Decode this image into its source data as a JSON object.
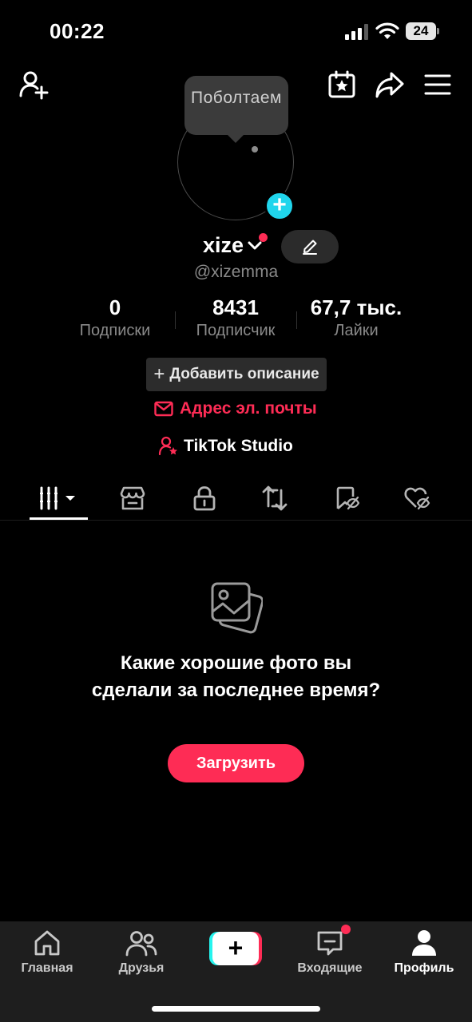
{
  "status_bar": {
    "time": "00:22",
    "battery": "24"
  },
  "tooltip": {
    "text": "Поболтаем"
  },
  "profile": {
    "username": "xize",
    "handle": "@xizemma",
    "stats": [
      {
        "value": "0",
        "label": "Подписки"
      },
      {
        "value": "8431",
        "label": "Подписчик"
      },
      {
        "value": "67,7 тыс.",
        "label": "Лайки"
      }
    ],
    "add_description": "Добавить описание",
    "email_label": "Адрес эл. почты",
    "studio_label": "TikTok Studio"
  },
  "tabs": [
    {
      "icon": "grid-icon",
      "active": true
    },
    {
      "icon": "shop-icon"
    },
    {
      "icon": "lock-icon"
    },
    {
      "icon": "repost-icon"
    },
    {
      "icon": "bookmark-hidden-icon"
    },
    {
      "icon": "heart-hidden-icon"
    }
  ],
  "empty_state": {
    "title": "Какие хорошие фото вы сделали за последнее время?",
    "button": "Загрузить"
  },
  "bottom_nav": {
    "home": "Главная",
    "friends": "Друзья",
    "inbox": "Входящие",
    "profile": "Профиль"
  },
  "colors": {
    "accent": "#fe2c55",
    "cyan": "#20d5ec",
    "background": "#000000",
    "nav_background": "#1e1e1e"
  }
}
